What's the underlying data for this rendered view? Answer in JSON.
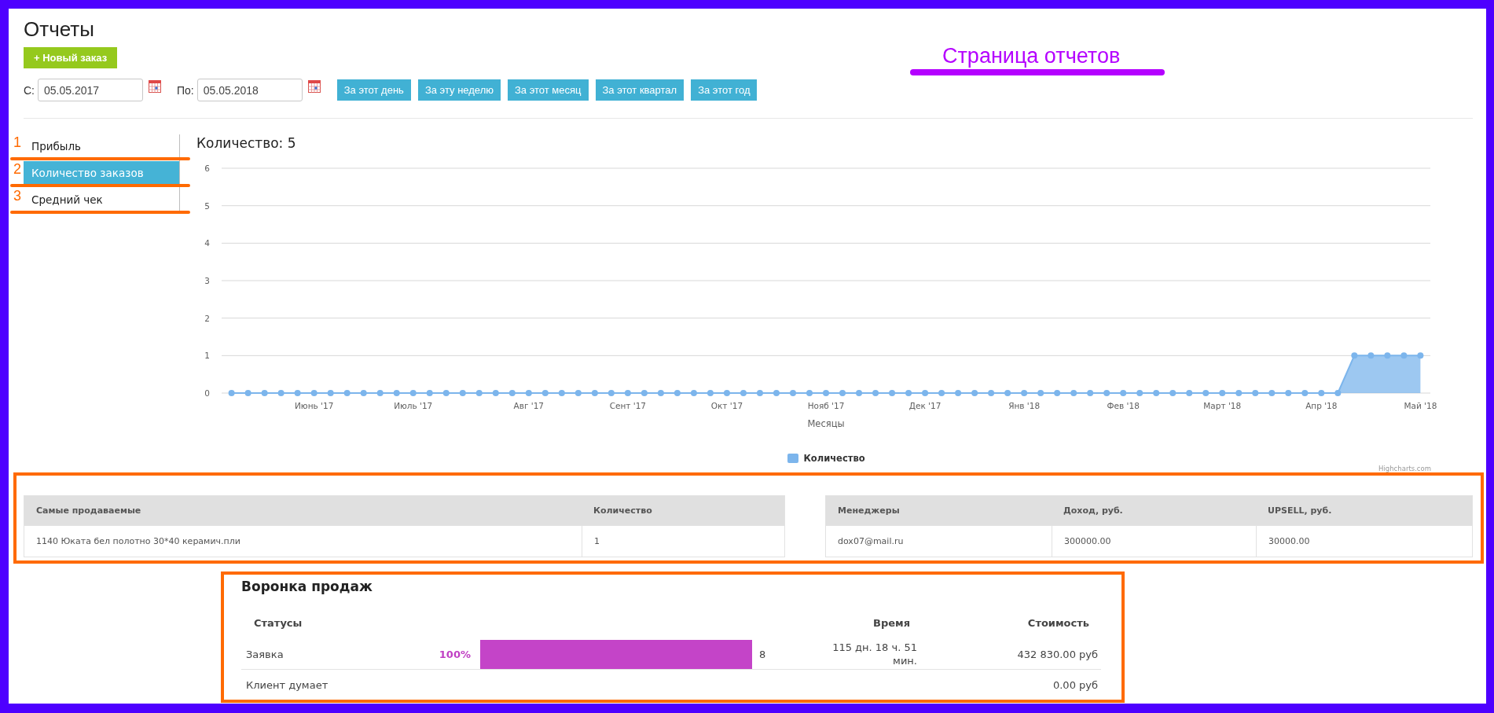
{
  "page": {
    "title": "Отчеты",
    "new_order_button": "+ Новый заказ"
  },
  "annotation": {
    "caption": "Страница отчетов"
  },
  "date_filter": {
    "from_label": "С:",
    "from_value": "05.05.2017",
    "to_label": "По:",
    "to_value": "05.05.2018",
    "period_buttons": [
      "За этот день",
      "За эту неделю",
      "За этот месяц",
      "За этот квартал",
      "За этот год"
    ]
  },
  "report_menu": [
    {
      "marker": "1",
      "label": "Прибыль",
      "selected": false
    },
    {
      "marker": "2",
      "label": "Количество заказов",
      "selected": true
    },
    {
      "marker": "3",
      "label": "Средний чек",
      "selected": false
    }
  ],
  "chart": {
    "title": "Количество: 5",
    "credits": "Highcharts.com",
    "chart_data": {
      "type": "area",
      "xlabel": "Месяцы",
      "categories": [
        null,
        null,
        null,
        null,
        null,
        "Июнь '17",
        null,
        null,
        null,
        null,
        null,
        "Июль '17",
        null,
        null,
        null,
        null,
        null,
        null,
        "Авг '17",
        null,
        null,
        null,
        null,
        null,
        "Сент '17",
        null,
        null,
        null,
        null,
        null,
        "Окт '17",
        null,
        null,
        null,
        null,
        null,
        "Нояб '17",
        null,
        null,
        null,
        null,
        null,
        "Дек '17",
        null,
        null,
        null,
        null,
        null,
        "Янв '18",
        null,
        null,
        null,
        null,
        null,
        "Фев '18",
        null,
        null,
        null,
        null,
        null,
        "Март '18",
        null,
        null,
        null,
        null,
        null,
        "Апр '18",
        null,
        null,
        null,
        null,
        null,
        "Май '18"
      ],
      "series": [
        {
          "name": "Количество",
          "color": "#7cb5ec",
          "values": [
            0,
            0,
            0,
            0,
            0,
            0,
            0,
            0,
            0,
            0,
            0,
            0,
            0,
            0,
            0,
            0,
            0,
            0,
            0,
            0,
            0,
            0,
            0,
            0,
            0,
            0,
            0,
            0,
            0,
            0,
            0,
            0,
            0,
            0,
            0,
            0,
            0,
            0,
            0,
            0,
            0,
            0,
            0,
            0,
            0,
            0,
            0,
            0,
            0,
            0,
            0,
            0,
            0,
            0,
            0,
            0,
            0,
            0,
            0,
            0,
            0,
            0,
            0,
            0,
            0,
            0,
            0,
            0,
            1,
            1,
            1,
            1,
            1
          ]
        }
      ],
      "ylim": [
        0,
        6
      ],
      "yticks": [
        0,
        1,
        2,
        3,
        4,
        5,
        6
      ],
      "grid": true
    }
  },
  "tables": [
    {
      "columns": [
        "Самые продаваемые",
        "Количество"
      ],
      "rows": [
        [
          "1140 Юката бел полотно 30*40 керамич.пли",
          "1"
        ]
      ]
    },
    {
      "columns": [
        "Менеджеры",
        "Доход, руб.",
        "UPSELL, руб."
      ],
      "rows": [
        [
          "dox07@mail.ru",
          "300000.00",
          "30000.00"
        ]
      ]
    }
  ],
  "funnel": {
    "title": "Воронка продаж",
    "columns": {
      "status": "Статусы",
      "time": "Время",
      "cost": "Стоимость"
    },
    "rows": [
      {
        "status": "Заявка",
        "percent": "100%",
        "level": 1,
        "count": "8",
        "time": "115 дн. 18 ч. 51 мин.",
        "cost": "432 830.00 руб"
      },
      {
        "status": "Клиент думает",
        "cost": "0.00 руб"
      }
    ]
  }
}
